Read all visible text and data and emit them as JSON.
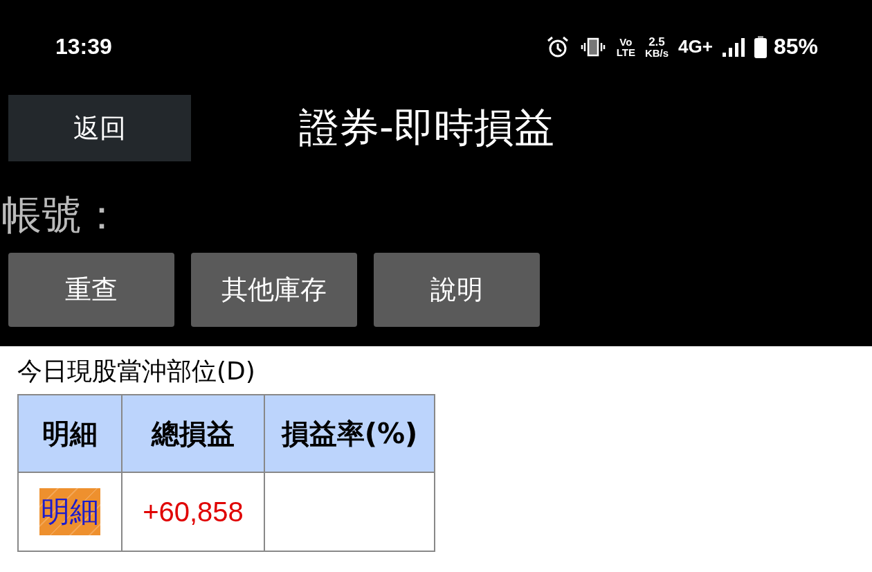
{
  "status_bar": {
    "time": "13:39",
    "volte_top": "Vo",
    "volte_bottom": "LTE",
    "speed_value": "2.5",
    "speed_unit": "KB/s",
    "network": "4G+",
    "battery": "85%"
  },
  "header": {
    "back_button": "返回",
    "title": "證券-即時損益"
  },
  "account": {
    "label": "帳號："
  },
  "actions": [
    "重查",
    "其他庫存",
    "說明"
  ],
  "section": {
    "title": "今日現股當沖部位(D)"
  },
  "table": {
    "columns": [
      "明細",
      "總損益",
      "損益率(%)"
    ],
    "rows": [
      {
        "detail_button": "明細",
        "total_pl": "+60,858"
      }
    ]
  }
}
